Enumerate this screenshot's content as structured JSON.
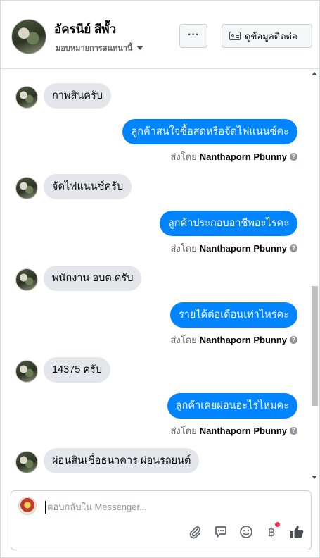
{
  "header": {
    "name": "อัครนีย์ สีพั้ว",
    "subtitle": "มอบหมายการสนทนานี้",
    "more_label": "···",
    "contact_label": "ดูข้อมูลติดต่อ"
  },
  "messages": [
    {
      "dir": "in",
      "text": "กาพสินครับ"
    },
    {
      "dir": "out",
      "text": "ลูกค้าสนใจซื้อสดหรือจัดไฟแนนซ์คะ",
      "sent_prefix": "ส่งโดย",
      "sent_name": "Nanthaporn Pbunny"
    },
    {
      "dir": "in",
      "text": "จัดไฟแนนซ์ครับ"
    },
    {
      "dir": "out",
      "text": "ลูกค้าประกอบอาชีพอะไรคะ",
      "sent_prefix": "ส่งโดย",
      "sent_name": "Nanthaporn Pbunny"
    },
    {
      "dir": "in",
      "text": "พนักงาน อบต.ครับ"
    },
    {
      "dir": "out",
      "text": "รายได้ต่อเดือนเท่าไหร่คะ",
      "sent_prefix": "ส่งโดย",
      "sent_name": "Nanthaporn Pbunny"
    },
    {
      "dir": "in",
      "text": "14375 ครับ"
    },
    {
      "dir": "out",
      "text": "ลูกค้าเคยผ่อนอะไรไหมคะ",
      "sent_prefix": "ส่งโดย",
      "sent_name": "Nanthaporn Pbunny"
    },
    {
      "dir": "in",
      "text": "ผ่อนสินเชื่อธนาคาร ผ่อนรถยนต์"
    }
  ],
  "composer": {
    "placeholder": "ตอบกลับใน Messenger..."
  },
  "colors": {
    "outgoing_bubble": "#0084ff",
    "incoming_bubble": "#e4e6eb",
    "like_icon": "#1877f2",
    "notification_dot": "#f02849"
  },
  "icons": [
    "attach-icon",
    "sticker-icon",
    "emoji-icon",
    "payment-icon",
    "like-icon"
  ]
}
